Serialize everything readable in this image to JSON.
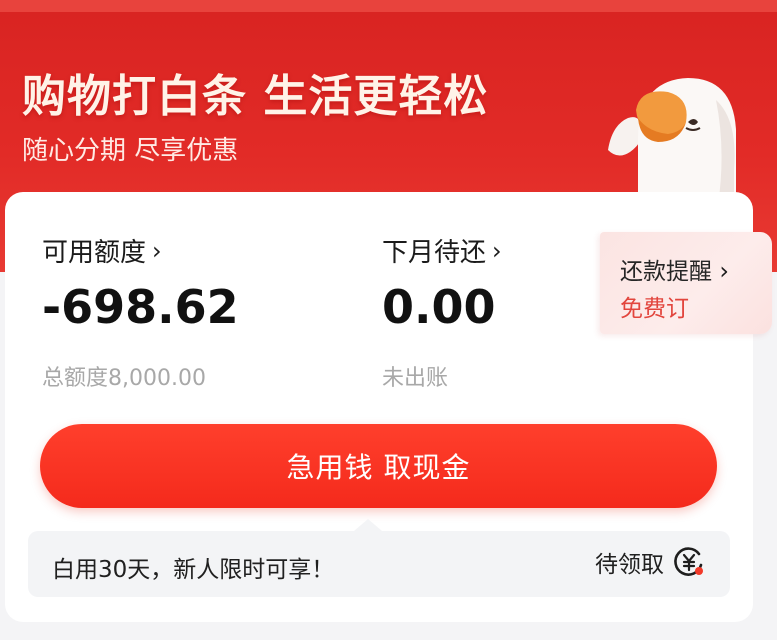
{
  "hero": {
    "title": "购物打白条 生活更轻松",
    "subtitle": "随心分期 尽享优惠"
  },
  "credit": {
    "available_label": "可用额度",
    "available_value": "-698.62",
    "total_label": "总额度8,000.00"
  },
  "repay": {
    "label": "下月待还",
    "value": "0.00",
    "status": "未出账"
  },
  "reminder": {
    "title": "还款提醒",
    "action": "免费订"
  },
  "cash_button": {
    "label": "急用钱 取现金"
  },
  "promo": {
    "text": "白用30天，新人限时可享！",
    "claim_label": "待领取"
  },
  "colors": {
    "brand_red": "#e22b27",
    "button_red": "#f42a1c",
    "reminder_red": "#e2453d"
  },
  "icons": {
    "chevron": "chevron-right-icon",
    "coin": "yuan-coin-icon",
    "mascot": "duck-mascot"
  }
}
